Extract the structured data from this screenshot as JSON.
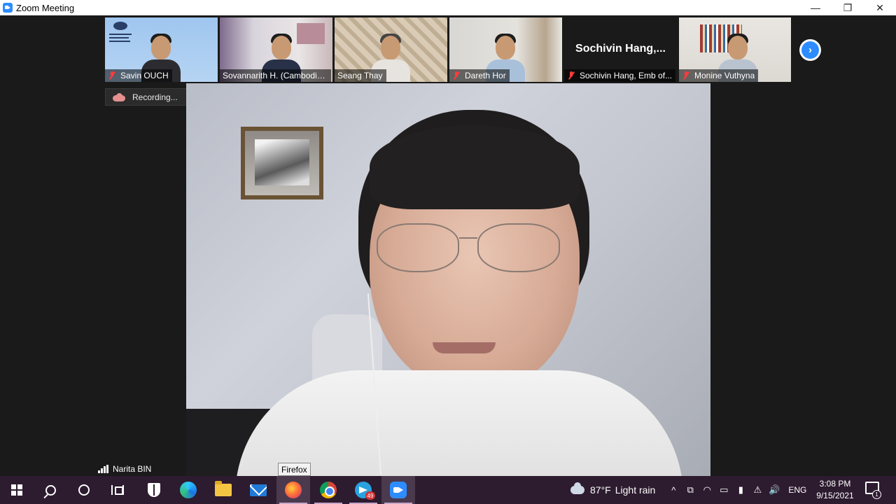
{
  "window": {
    "title": "Zoom Meeting",
    "minimize": "—",
    "restore": "❐",
    "close": "✕"
  },
  "thumbnails": [
    {
      "name": "Savin OUCH",
      "muted": true
    },
    {
      "name": "Sovannarith H. (Cambodia...",
      "muted": false
    },
    {
      "name": "Seang Thay",
      "muted": false
    },
    {
      "name": "Dareth Hor",
      "muted": true
    },
    {
      "name": "Sochivin Hang, Emb of...",
      "display": "Sochivin  Hang,...",
      "muted": true
    },
    {
      "name": "Monine Vuthyna",
      "muted": true
    }
  ],
  "next_button": "›",
  "recording": {
    "label": "Recording..."
  },
  "speaker": {
    "name": "Narita BIN"
  },
  "tooltip": {
    "text": "Firefox"
  },
  "taskbar": {
    "telegram_badge": "49",
    "weather": "87°F",
    "condition": "Light rain",
    "language": "ENG",
    "time": "3:08 PM",
    "date": "9/15/2021",
    "notification_count": "1",
    "tray_icons": [
      "^",
      "⧉",
      "◠",
      "▭",
      "▮",
      "⚠",
      "🔊"
    ]
  }
}
